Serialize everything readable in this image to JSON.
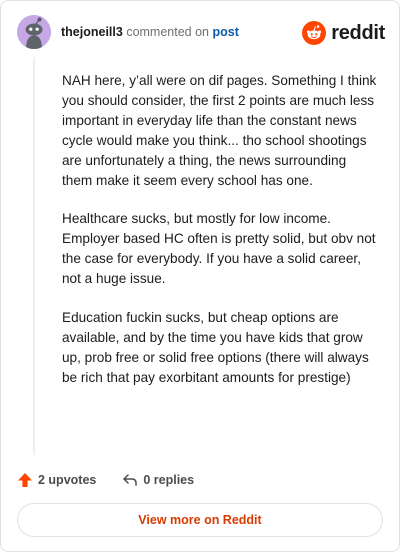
{
  "comment": {
    "username": "thejoneill3",
    "action_text": "commented on",
    "post_link": "post",
    "paragraphs": [
      "NAH here, y’all were on dif pages. Something I think you should consider, the first 2 points are much less important in everyday life than the constant news cycle would make you think... tho school shootings are unfortunately a thing, the news surrounding them make it seem every school has one.",
      "Healthcare sucks, but mostly for low income. Employer based HC often is pretty solid, but obv not the case for everybody. If you have a solid career, not a huge issue.",
      "Education fuckin sucks, but cheap options are available, and by the time you have kids that grow up, prob free or solid free options (there will always be rich that pay exorbitant amounts for prestige)"
    ]
  },
  "brand": {
    "wordmark": "reddit",
    "logo_icon": "reddit-snoo-icon",
    "accent": "#ff4500"
  },
  "actions": {
    "upvotes": "2 upvotes",
    "replies": "0 replies",
    "upvote_icon": "upvote-arrow-icon",
    "reply_icon": "reply-arrow-icon"
  },
  "footer": {
    "view_more": "View more on Reddit",
    "view_more_color": "#d93a00"
  }
}
